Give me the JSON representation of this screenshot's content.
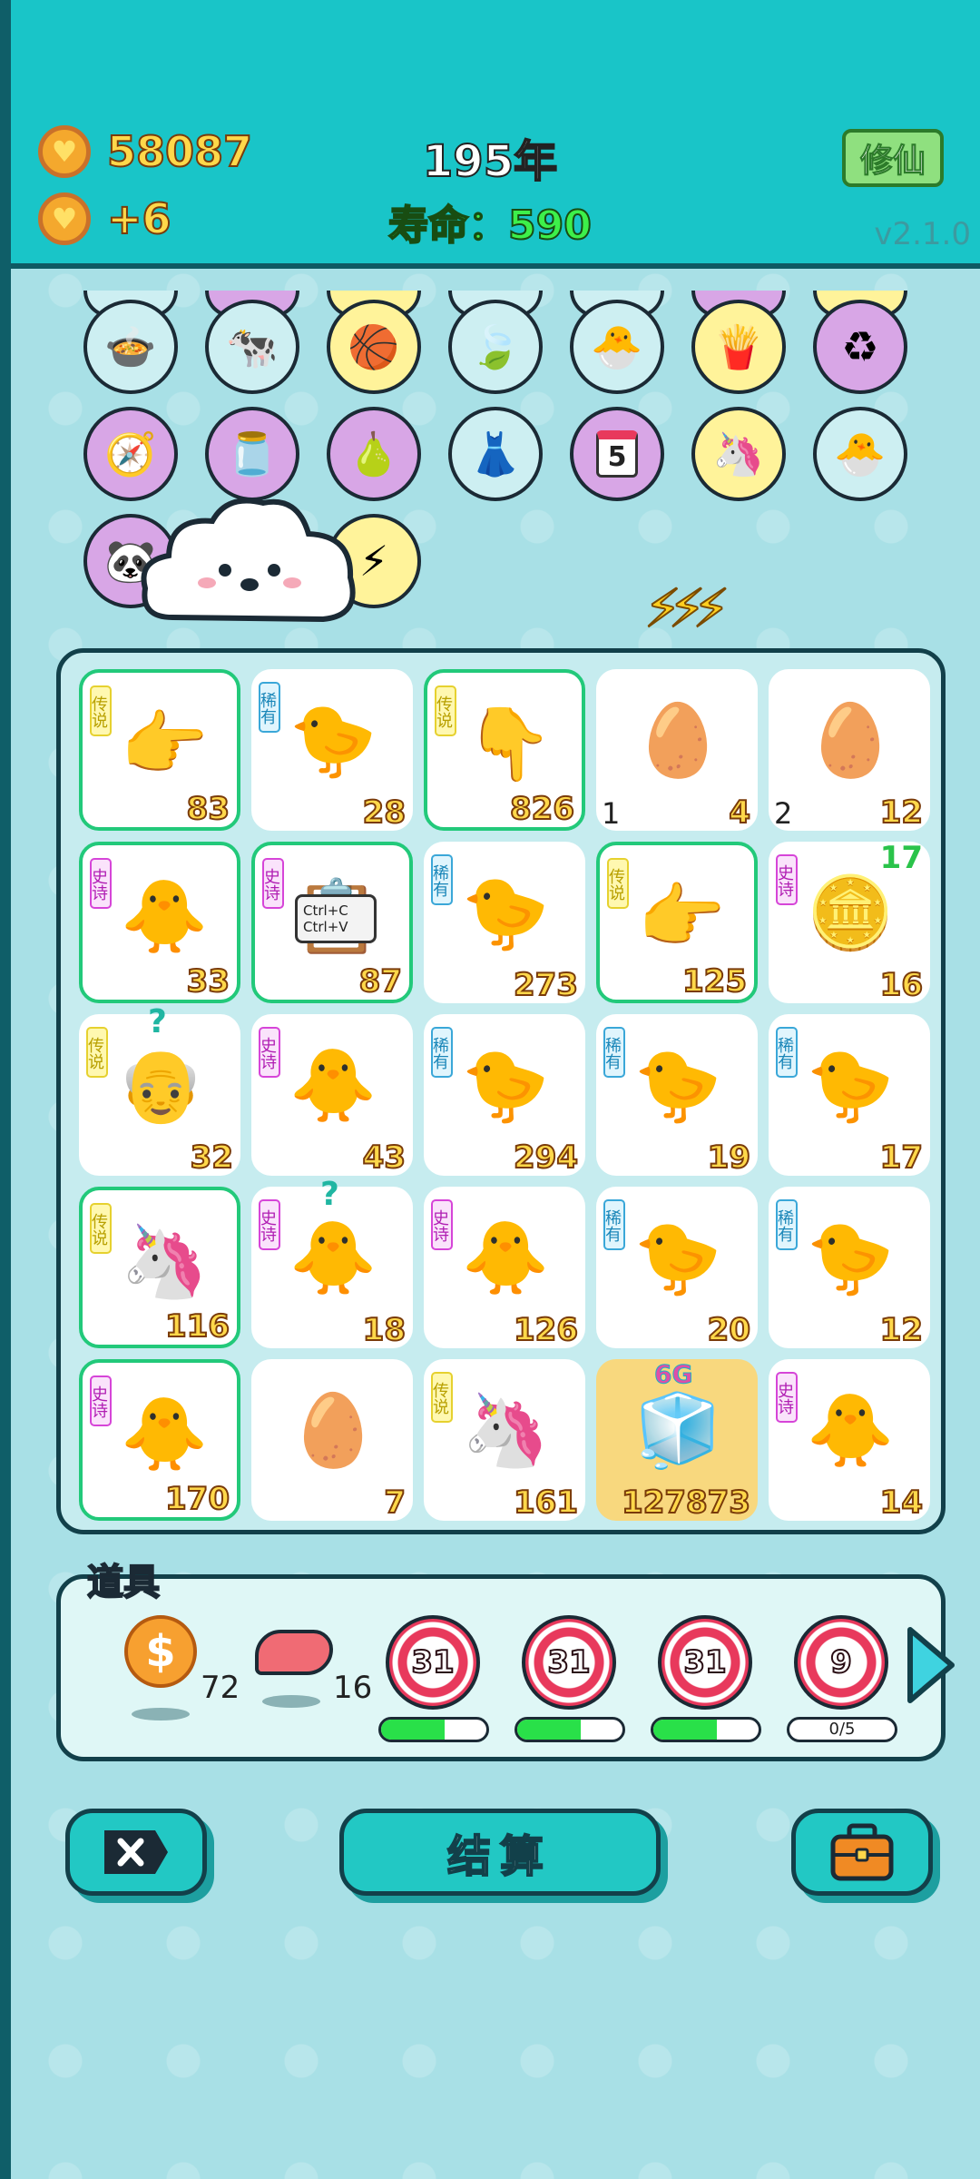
{
  "header": {
    "coins": "58087",
    "coin_rate": "+6",
    "year": "195年",
    "lifespan": "寿命：590",
    "cultivate_label": "修仙",
    "version": "v2.1.0"
  },
  "skills": {
    "row1": [
      "duck-pot-icon",
      "twin-cows-icon",
      "basketballs-icon",
      "leaf-icon",
      "chick-egg-icon",
      "fries-icon",
      "recycle-icon"
    ],
    "row2": [
      "compass-icon",
      "yogurt-jar-icon",
      "pomelo-icon",
      "skirt-icon",
      "calendar-icon",
      "unicorn-icon",
      "chick-egg-icon"
    ],
    "row3": [
      "panda-icon",
      "cloud-face-icon",
      "lightning-icon"
    ],
    "calendar_day": "5"
  },
  "board": {
    "cells": [
      {
        "rarity": "传说",
        "rarity_class": "cs",
        "icon": "pointing-hand-icon",
        "art": "👉",
        "count": "83",
        "legend": true
      },
      {
        "rarity": "稀有",
        "rarity_class": "xy",
        "icon": "chick-icon",
        "art": "🐤",
        "count": "28"
      },
      {
        "rarity": "传说",
        "rarity_class": "cs",
        "icon": "pointing-down-hand-icon",
        "art": "👇",
        "count": "826",
        "legend": true
      },
      {
        "icon": "egg-icon",
        "art": "🥚",
        "count": "4",
        "level": "1"
      },
      {
        "icon": "egg-icon",
        "art": "🥚",
        "count": "12",
        "level": "2"
      },
      {
        "rarity": "史诗",
        "rarity_class": "ss",
        "icon": "gray-hair-chick-icon",
        "art": "🐥",
        "count": "33",
        "legend": true
      },
      {
        "rarity": "史诗",
        "rarity_class": "ss",
        "icon": "copy-paste-icon",
        "art": "📋",
        "count": "87",
        "legend": true,
        "sub": "Ctrl+C Ctrl+V"
      },
      {
        "rarity": "稀有",
        "rarity_class": "xy",
        "icon": "chick-icon",
        "art": "🐤",
        "count": "273"
      },
      {
        "rarity": "传说",
        "rarity_class": "cs",
        "icon": "pointing-hand-icon",
        "art": "👉",
        "count": "125",
        "legend": true
      },
      {
        "rarity": "史诗",
        "rarity_class": "ss",
        "icon": "coin-pie-icon",
        "art": "🪙",
        "count": "16",
        "top": "17"
      },
      {
        "rarity": "传说",
        "rarity_class": "cs",
        "icon": "bald-old-man-icon",
        "art": "👴",
        "count": "32",
        "q": "?"
      },
      {
        "rarity": "史诗",
        "rarity_class": "ss",
        "icon": "gray-hair-chick-icon",
        "art": "🐥",
        "count": "43"
      },
      {
        "rarity": "稀有",
        "rarity_class": "xy",
        "icon": "chick-icon",
        "art": "🐤",
        "count": "294"
      },
      {
        "rarity": "稀有",
        "rarity_class": "xy",
        "icon": "chick-icon",
        "art": "🐤",
        "count": "19"
      },
      {
        "rarity": "稀有",
        "rarity_class": "xy",
        "icon": "chick-icon",
        "art": "🐤",
        "count": "17"
      },
      {
        "rarity": "传说",
        "rarity_class": "cs",
        "icon": "unicorn-icon",
        "art": "🦄",
        "count": "116",
        "legend": true
      },
      {
        "rarity": "史诗",
        "rarity_class": "ss",
        "icon": "gray-hair-chick-basketball-icon",
        "art": "🐥",
        "count": "18",
        "q": "?"
      },
      {
        "rarity": "史诗",
        "rarity_class": "ss",
        "icon": "gray-hair-chick-icon",
        "art": "🐥",
        "count": "126"
      },
      {
        "rarity": "稀有",
        "rarity_class": "xy",
        "icon": "chick-basketball-icon",
        "art": "🐤",
        "count": "20"
      },
      {
        "rarity": "稀有",
        "rarity_class": "xy",
        "icon": "chick-icon",
        "art": "🐤",
        "count": "12"
      },
      {
        "rarity": "史诗",
        "rarity_class": "ss",
        "icon": "gray-hair-chick-icon",
        "art": "🐥",
        "count": "170",
        "legend": true
      },
      {
        "icon": "egg-icon",
        "art": "🥚",
        "count": "7"
      },
      {
        "rarity": "传说",
        "rarity_class": "cs",
        "icon": "unicorn-basketball-icon",
        "art": "🦄",
        "count": "161"
      },
      {
        "icon": "fridge-icon",
        "art": "🧊",
        "count": "127873",
        "fridge": true,
        "tag": "6G"
      },
      {
        "rarity": "史诗",
        "rarity_class": "ss",
        "icon": "gray-hair-chick-icon",
        "art": "🐥",
        "count": "14"
      }
    ]
  },
  "tools": {
    "label": "道具",
    "coin_count": "72",
    "liver_count": "16",
    "targets": [
      {
        "value": "31",
        "progress": 0.6
      },
      {
        "value": "31",
        "progress": 0.6
      },
      {
        "value": "31",
        "progress": 0.6
      },
      {
        "value": "9",
        "progress": 0,
        "progress_text": "0/5"
      }
    ]
  },
  "buttons": {
    "settle_label": "结算"
  }
}
